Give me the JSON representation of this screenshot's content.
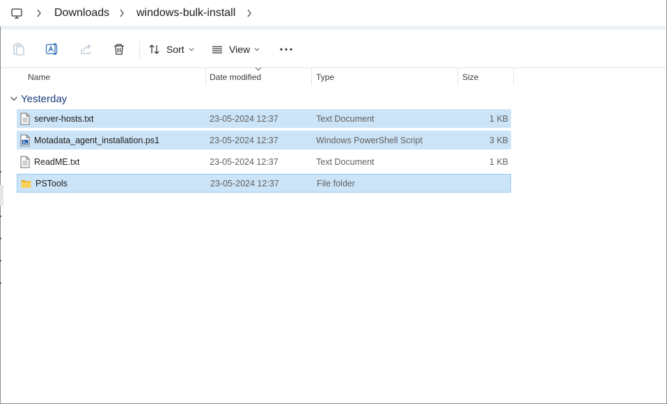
{
  "breadcrumb": {
    "items": [
      {
        "label": "Downloads"
      },
      {
        "label": "windows-bulk-install"
      }
    ]
  },
  "toolbar": {
    "sort_label": "Sort",
    "view_label": "View"
  },
  "columns": {
    "name": "Name",
    "date": "Date modified",
    "type": "Type",
    "size": "Size"
  },
  "group": {
    "label": "Yesterday"
  },
  "files": [
    {
      "name": "server-hosts.txt",
      "date": "23-05-2024 12:37",
      "type": "Text Document",
      "size": "1 KB",
      "icon": "text-file-icon",
      "selected": true
    },
    {
      "name": "Motadata_agent_installation.ps1",
      "date": "23-05-2024 12:37",
      "type": "Windows PowerShell Script",
      "size": "3 KB",
      "icon": "powershell-file-icon",
      "selected": true
    },
    {
      "name": "ReadME.txt",
      "date": "23-05-2024 12:37",
      "type": "Text Document",
      "size": "1 KB",
      "icon": "text-file-icon",
      "selected": false
    },
    {
      "name": "PSTools",
      "date": "23-05-2024 12:37",
      "type": "File folder",
      "size": "",
      "icon": "folder-icon",
      "selected": true
    }
  ],
  "colors": {
    "selection": "#cce4f7",
    "group_text": "#1a3d7c"
  }
}
